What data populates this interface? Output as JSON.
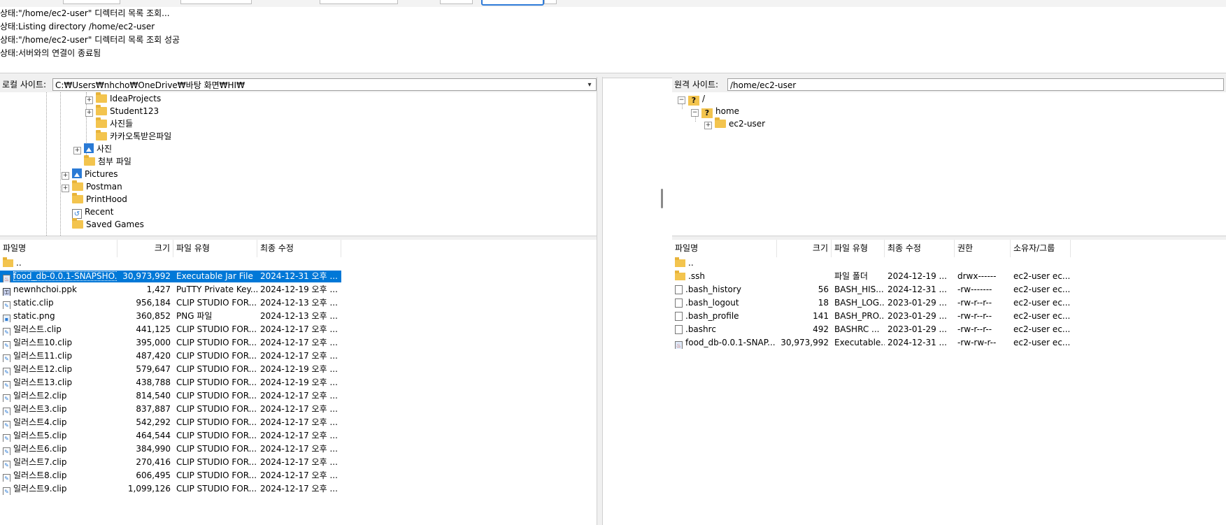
{
  "log": {
    "lines": [
      {
        "prefix": "상태:",
        "text": "\"/home/ec2-user\" 디렉터리 목록 조회..."
      },
      {
        "prefix": "상태:",
        "text": "Listing directory /home/ec2-user"
      },
      {
        "prefix": "상태:",
        "text": "\"/home/ec2-user\" 디렉터리 목록 조회 성공"
      },
      {
        "prefix": "상태:",
        "text": "서버와의 연결이 종료됨"
      }
    ]
  },
  "local": {
    "site_label": "로컬 사이트:",
    "path": "C:₩Users₩nhcho₩OneDrive₩바탕 화면₩HI₩",
    "tree": [
      {
        "label": "IdeaProjects",
        "expander": "+",
        "icon": "folder-icon"
      },
      {
        "label": "Student123",
        "expander": "+",
        "icon": "folder-icon"
      },
      {
        "label": "사진들",
        "expander": "",
        "icon": "folder-icon"
      },
      {
        "label": "카카오톡받은파일",
        "expander": "",
        "icon": "folder-icon"
      },
      {
        "label": "사진",
        "expander": "+",
        "icon": "pictures-icon"
      },
      {
        "label": "첨부 파일",
        "expander": "",
        "icon": "folder-icon"
      },
      {
        "label": "Pictures",
        "expander": "+",
        "icon": "pictures-icon"
      },
      {
        "label": "Postman",
        "expander": "+",
        "icon": "folder-icon"
      },
      {
        "label": "PrintHood",
        "expander": "",
        "icon": "folder-icon"
      },
      {
        "label": "Recent",
        "expander": "",
        "icon": "recent-icon"
      },
      {
        "label": "Saved Games",
        "expander": "",
        "icon": "folder-icon"
      }
    ],
    "columns": [
      "파일명",
      "크기",
      "파일 유형",
      "최종 수정"
    ],
    "files": [
      {
        "name": "..",
        "size": "",
        "type": "",
        "modified": "",
        "icon": "folder"
      },
      {
        "name": "food_db-0.0.1-SNAPSHO...",
        "size": "30,973,992",
        "type": "Executable Jar File",
        "modified": "2024-12-31 오후 ...",
        "icon": "jar",
        "selected": true
      },
      {
        "name": "newnhchoi.ppk",
        "size": "1,427",
        "type": "PuTTY Private Key...",
        "modified": "2024-12-19 오후 ...",
        "icon": "ppk"
      },
      {
        "name": "static.clip",
        "size": "956,184",
        "type": "CLIP STUDIO FOR...",
        "modified": "2024-12-13 오후 ...",
        "icon": "clip"
      },
      {
        "name": "static.png",
        "size": "360,852",
        "type": "PNG 파일",
        "modified": "2024-12-13 오후 ...",
        "icon": "png"
      },
      {
        "name": "일러스트.clip",
        "size": "441,125",
        "type": "CLIP STUDIO FOR...",
        "modified": "2024-12-17 오후 ...",
        "icon": "clip"
      },
      {
        "name": "일러스트10.clip",
        "size": "395,000",
        "type": "CLIP STUDIO FOR...",
        "modified": "2024-12-17 오후 ...",
        "icon": "clip"
      },
      {
        "name": "일러스트11.clip",
        "size": "487,420",
        "type": "CLIP STUDIO FOR...",
        "modified": "2024-12-17 오후 ...",
        "icon": "clip"
      },
      {
        "name": "일러스트12.clip",
        "size": "579,647",
        "type": "CLIP STUDIO FOR...",
        "modified": "2024-12-19 오후 ...",
        "icon": "clip"
      },
      {
        "name": "일러스트13.clip",
        "size": "438,788",
        "type": "CLIP STUDIO FOR...",
        "modified": "2024-12-19 오후 ...",
        "icon": "clip"
      },
      {
        "name": "일러스트2.clip",
        "size": "814,540",
        "type": "CLIP STUDIO FOR...",
        "modified": "2024-12-17 오후 ...",
        "icon": "clip"
      },
      {
        "name": "일러스트3.clip",
        "size": "837,887",
        "type": "CLIP STUDIO FOR...",
        "modified": "2024-12-17 오후 ...",
        "icon": "clip"
      },
      {
        "name": "일러스트4.clip",
        "size": "542,292",
        "type": "CLIP STUDIO FOR...",
        "modified": "2024-12-17 오후 ...",
        "icon": "clip"
      },
      {
        "name": "일러스트5.clip",
        "size": "464,544",
        "type": "CLIP STUDIO FOR...",
        "modified": "2024-12-17 오후 ...",
        "icon": "clip"
      },
      {
        "name": "일러스트6.clip",
        "size": "384,990",
        "type": "CLIP STUDIO FOR...",
        "modified": "2024-12-17 오후 ...",
        "icon": "clip"
      },
      {
        "name": "일러스트7.clip",
        "size": "270,416",
        "type": "CLIP STUDIO FOR...",
        "modified": "2024-12-17 오후 ...",
        "icon": "clip"
      },
      {
        "name": "일러스트8.clip",
        "size": "606,495",
        "type": "CLIP STUDIO FOR...",
        "modified": "2024-12-17 오후 ...",
        "icon": "clip"
      },
      {
        "name": "일러스트9.clip",
        "size": "1,099,126",
        "type": "CLIP STUDIO FOR...",
        "modified": "2024-12-17 오후 ...",
        "icon": "clip"
      }
    ]
  },
  "remote": {
    "site_label": "원격 사이트:",
    "path": "/home/ec2-user",
    "tree": [
      {
        "label": "/",
        "expander": "−",
        "icon": "question-folder-icon"
      },
      {
        "label": "home",
        "expander": "−",
        "icon": "question-folder-icon"
      },
      {
        "label": "ec2-user",
        "expander": "+",
        "icon": "folder-icon"
      }
    ],
    "columns": [
      "파일명",
      "크기",
      "파일 유형",
      "최종 수정",
      "권한",
      "소유자/그룹"
    ],
    "files": [
      {
        "name": "..",
        "size": "",
        "type": "",
        "modified": "",
        "perm": "",
        "owner": "",
        "icon": "folder"
      },
      {
        "name": ".ssh",
        "size": "",
        "type": "파일 폴더",
        "modified": "2024-12-19 ...",
        "perm": "drwx------",
        "owner": "ec2-user ec...",
        "icon": "folder"
      },
      {
        "name": ".bash_history",
        "size": "56",
        "type": "BASH_HIS...",
        "modified": "2024-12-31 ...",
        "perm": "-rw-------",
        "owner": "ec2-user ec...",
        "icon": "file"
      },
      {
        "name": ".bash_logout",
        "size": "18",
        "type": "BASH_LOG...",
        "modified": "2023-01-29 ...",
        "perm": "-rw-r--r--",
        "owner": "ec2-user ec...",
        "icon": "file"
      },
      {
        "name": ".bash_profile",
        "size": "141",
        "type": "BASH_PRO...",
        "modified": "2023-01-29 ...",
        "perm": "-rw-r--r--",
        "owner": "ec2-user ec...",
        "icon": "file"
      },
      {
        "name": ".bashrc",
        "size": "492",
        "type": "BASHRC ...",
        "modified": "2023-01-29 ...",
        "perm": "-rw-r--r--",
        "owner": "ec2-user ec...",
        "icon": "file"
      },
      {
        "name": "food_db-0.0.1-SNAP...",
        "size": "30,973,992",
        "type": "Executable...",
        "modified": "2024-12-31 ...",
        "perm": "-rw-rw-r--",
        "owner": "ec2-user ec...",
        "icon": "jar"
      }
    ]
  }
}
